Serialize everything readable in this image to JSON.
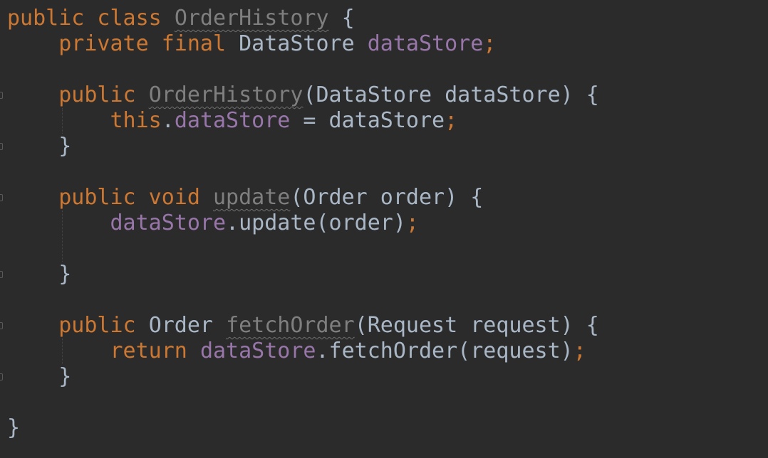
{
  "editor": {
    "language": "java",
    "colors": {
      "background": "#2b2b2b",
      "keyword": "#cc7832",
      "field": "#9876aa",
      "text": "#a9b7c6",
      "unused": "#7f7f7f"
    },
    "lines": [
      {
        "tokens": [
          {
            "t": "public class ",
            "c": "kw"
          },
          {
            "t": "OrderHistory",
            "c": "unused",
            "wavy": true
          },
          {
            "t": " {",
            "c": "plain"
          }
        ]
      },
      {
        "tokens": [
          {
            "t": "    private final ",
            "c": "kw"
          },
          {
            "t": "DataStore ",
            "c": "plain"
          },
          {
            "t": "dataStore",
            "c": "fld"
          },
          {
            "t": ";",
            "c": "kw"
          }
        ]
      },
      {
        "tokens": []
      },
      {
        "tokens": [
          {
            "t": "    public ",
            "c": "kw"
          },
          {
            "t": "OrderHistory",
            "c": "unused",
            "wavy": true
          },
          {
            "t": "(DataStore dataStore) {",
            "c": "plain"
          }
        ]
      },
      {
        "tokens": [
          {
            "t": "        this",
            "c": "kw"
          },
          {
            "t": ".",
            "c": "plain"
          },
          {
            "t": "dataStore",
            "c": "fld"
          },
          {
            "t": " = dataStore",
            "c": "plain"
          },
          {
            "t": ";",
            "c": "kw"
          }
        ]
      },
      {
        "tokens": [
          {
            "t": "    }",
            "c": "plain"
          }
        ]
      },
      {
        "tokens": []
      },
      {
        "tokens": [
          {
            "t": "    public void ",
            "c": "kw"
          },
          {
            "t": "update",
            "c": "unused",
            "wavy": true
          },
          {
            "t": "(Order order) {",
            "c": "plain"
          }
        ]
      },
      {
        "tokens": [
          {
            "t": "        dataStore",
            "c": "fld"
          },
          {
            "t": ".update(order)",
            "c": "plain"
          },
          {
            "t": ";",
            "c": "kw"
          }
        ]
      },
      {
        "tokens": []
      },
      {
        "tokens": [
          {
            "t": "    }",
            "c": "plain"
          }
        ]
      },
      {
        "tokens": []
      },
      {
        "tokens": [
          {
            "t": "    public ",
            "c": "kw"
          },
          {
            "t": "Order ",
            "c": "plain"
          },
          {
            "t": "fetchOrder",
            "c": "unused",
            "wavy": true
          },
          {
            "t": "(Request request) {",
            "c": "plain"
          }
        ]
      },
      {
        "tokens": [
          {
            "t": "        return ",
            "c": "kw"
          },
          {
            "t": "dataStore",
            "c": "fld"
          },
          {
            "t": ".fetchOrder(request)",
            "c": "plain"
          },
          {
            "t": ";",
            "c": "kw"
          }
        ]
      },
      {
        "tokens": [
          {
            "t": "    }",
            "c": "plain"
          }
        ]
      },
      {
        "tokens": []
      },
      {
        "tokens": [
          {
            "t": "}",
            "c": "plain"
          }
        ]
      }
    ]
  }
}
